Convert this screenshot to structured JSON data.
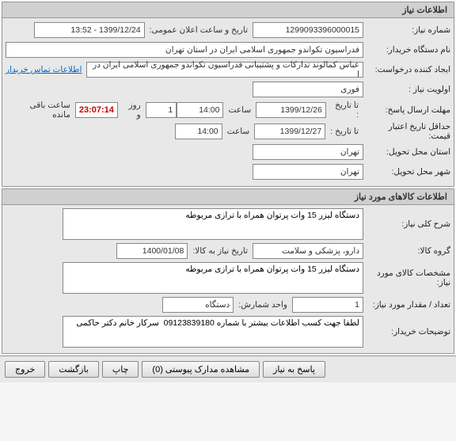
{
  "panel1": {
    "title": "اطلاعات نیاز",
    "request_no_label": "شماره نیاز:",
    "request_no": "1299093396000015",
    "announce_label": "تاریخ و ساعت اعلان عمومی:",
    "announce_value": "1399/12/24 - 13:52",
    "buyer_org_label": "نام دستگاه خریدار:",
    "buyer_org": "فدراسیون تکواندو جمهوری اسلامی ایران در استان تهران",
    "creator_label": "ایجاد کننده درخواست:",
    "creator": "عباس کمالوند تدارکات و پشتیبانی فدراسیون تکواندو جمهوری اسلامی ایران در ا",
    "contact_link": "اطلاعات تماس خریدار",
    "priority_label": "اولویت نیاز :",
    "priority": "فوری",
    "deadline_label": "مهلت ارسال پاسخ:",
    "to_date_label": "تا تاریخ :",
    "deadline_date": "1399/12/26",
    "hour_label": "ساعت",
    "deadline_time": "14:00",
    "day_count": "1",
    "day_label": "روز و",
    "countdown": "23:07:14",
    "remaining_label": "ساعت باقی مانده",
    "validity_label": "حداقل تاریخ اعتبار قیمت:",
    "validity_date": "1399/12/27",
    "validity_time": "14:00",
    "delivery_province_label": "استان محل تحویل:",
    "delivery_province": "تهران",
    "delivery_city_label": "شهر محل تحویل:",
    "delivery_city": "تهران"
  },
  "panel2": {
    "title": "اطلاعات کالاهای مورد نیاز",
    "desc_label": "شرح کلی نیاز:",
    "desc": "دستگاه لیزر 15 وات پرتوان همراه با ترازی مربوطه",
    "group_label": "گروه کالا:",
    "group": "دارو، پزشکی و سلامت",
    "need_date_label": "تاریخ نیاز به کالا:",
    "need_date": "1400/01/08",
    "spec_label": "مشخصات کالای مورد نیاز:",
    "spec": "دستگاه لیزر 15 وات پرتوان همراه با ترازی مربوطه",
    "qty_label": "تعداد / مقدار مورد نیاز:",
    "qty": "1",
    "unit_label": "واحد شمارش:",
    "unit": "دستگاه",
    "notes_label": "توضیحات خریدار:",
    "notes": "لطفا جهت کسب اطلاعات بیشتر با شماره 09123839180  سرکار خانم دکتر حاکمی"
  },
  "buttons": {
    "respond": "پاسخ به نیاز",
    "attachments": "مشاهده مدارک پیوستی (0)",
    "print": "چاپ",
    "back": "بازگشت",
    "exit": "خروج"
  }
}
